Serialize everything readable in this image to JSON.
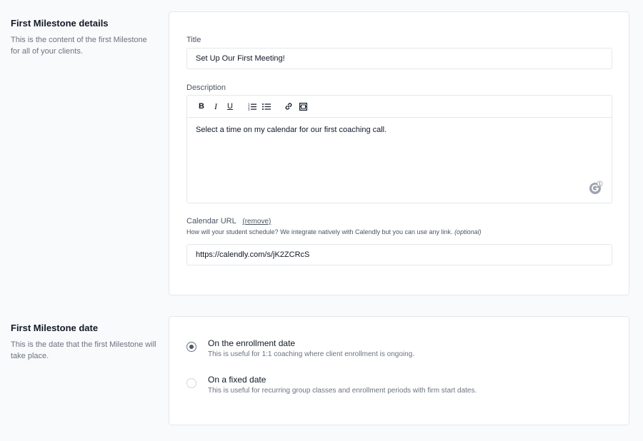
{
  "details_section": {
    "title": "First Milestone details",
    "description": "This is the content of the first Milestone for all of your clients."
  },
  "details_card": {
    "title_label": "Title",
    "title_value": "Set Up Our First Meeting!",
    "description_label": "Description",
    "toolbar": {
      "bold": "B",
      "italic": "I",
      "underline": "U"
    },
    "description_value": "Select a time on my calendar for our first coaching call.",
    "grammarly_badge": "1",
    "calendar_label": "Calendar URL",
    "calendar_remove": "(remove)",
    "calendar_hint": "How will your student schedule? We integrate natively with Calendly but you can use any link.",
    "calendar_optional": "(optional)",
    "calendar_value": "https://calendly.com/s/jK2ZCRcS"
  },
  "date_section": {
    "title": "First Milestone date",
    "description": "This is the date that the first Milestone will take place."
  },
  "date_card": {
    "options": [
      {
        "title": "On the enrollment date",
        "description": "This is useful for 1:1 coaching where client enrollment is ongoing.",
        "selected": true
      },
      {
        "title": "On a fixed date",
        "description": "This is useful for recurring group classes and enrollment periods with firm start dates.",
        "selected": false
      }
    ]
  }
}
